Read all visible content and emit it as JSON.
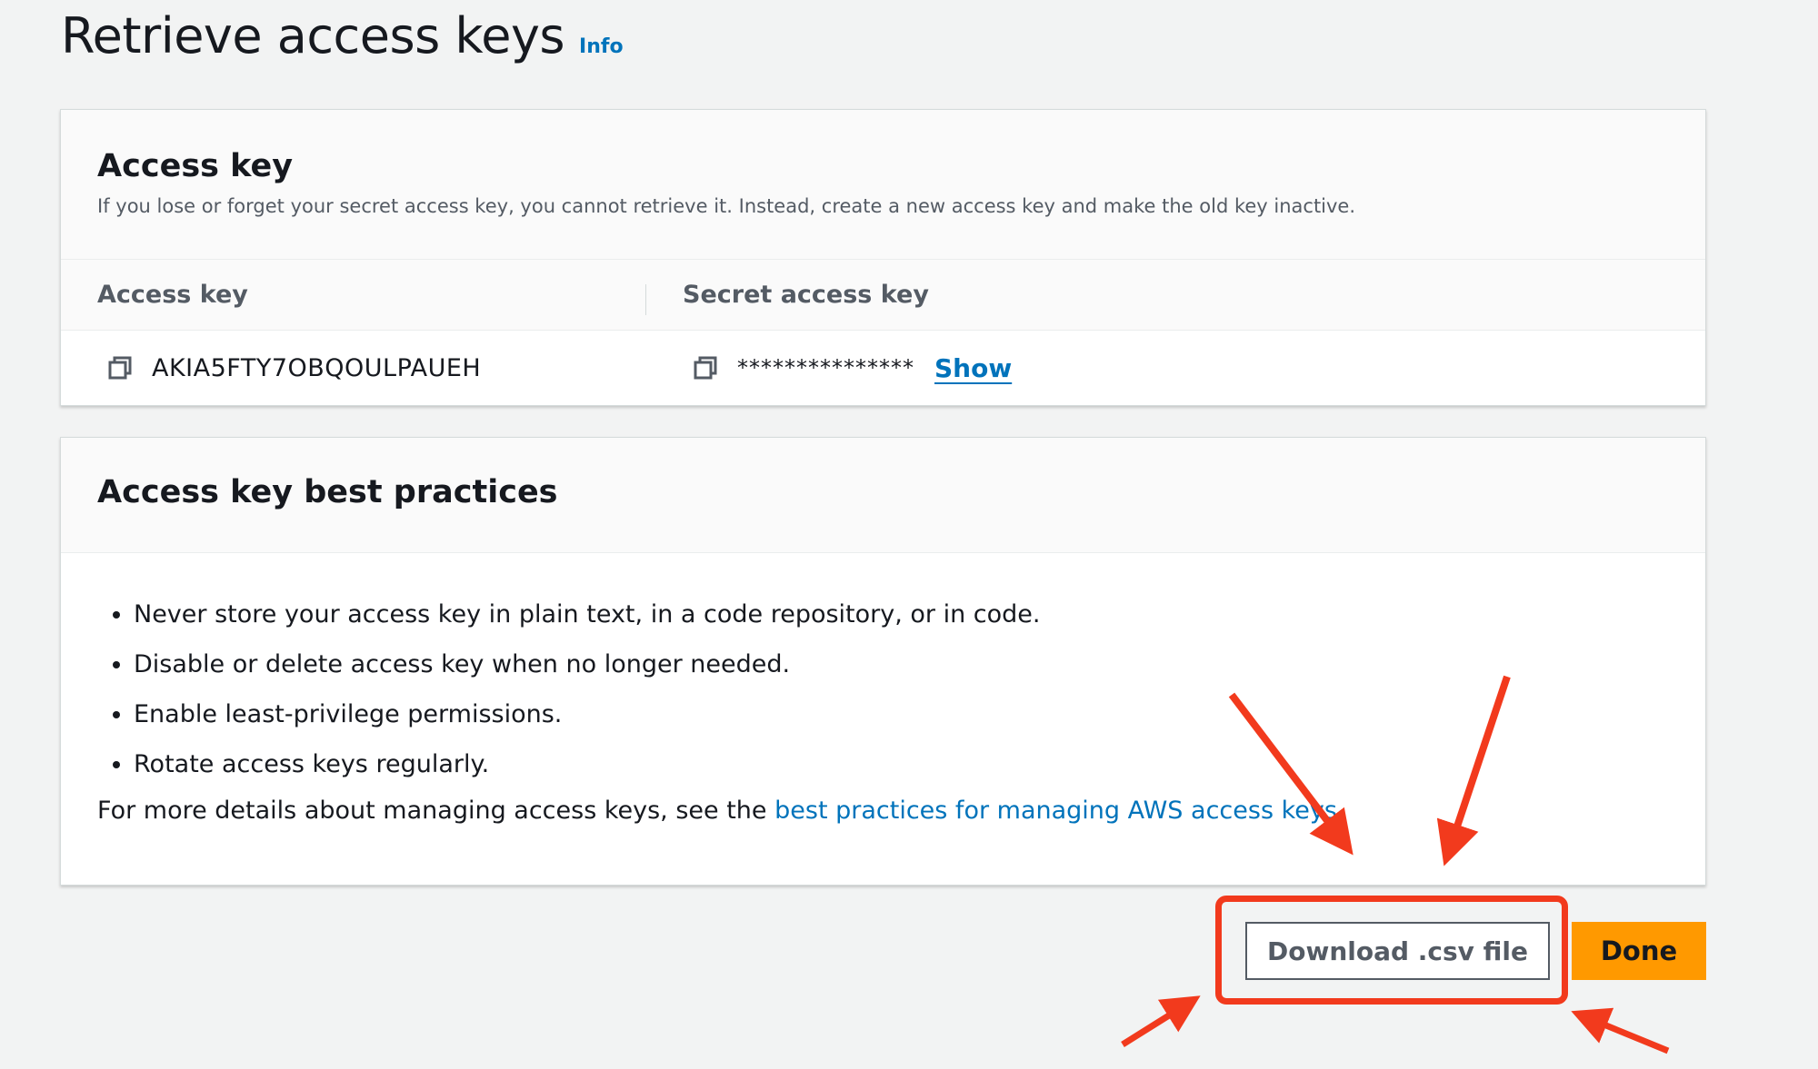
{
  "page": {
    "title": "Retrieve access keys",
    "info_link": "Info"
  },
  "access_key_panel": {
    "title": "Access key",
    "description": "If you lose or forget your secret access key, you cannot retrieve it. Instead, create a new access key and make the old key inactive.",
    "columns": {
      "access_key_label": "Access key",
      "secret_key_label": "Secret access key"
    },
    "access_key_value": "AKIA5FTY7OBQOULPAUEH",
    "secret_key_masked": "***************",
    "show_label": "Show",
    "copy_icon": "copy-icon"
  },
  "best_practices_panel": {
    "title": "Access key best practices",
    "items": [
      "Never store your access key in plain text, in a code repository, or in code.",
      "Disable or delete access key when no longer needed.",
      "Enable least-privilege permissions.",
      "Rotate access keys regularly."
    ],
    "more_prefix": "For more details about managing access keys, see the ",
    "more_link": "best practices for managing AWS access keys",
    "more_suffix": "."
  },
  "actions": {
    "download_label": "Download .csv file",
    "done_label": "Done"
  },
  "colors": {
    "link": "#0073bb",
    "primary_button": "#ff9900",
    "annotation": "#f23a1d",
    "background": "#f2f3f3"
  }
}
